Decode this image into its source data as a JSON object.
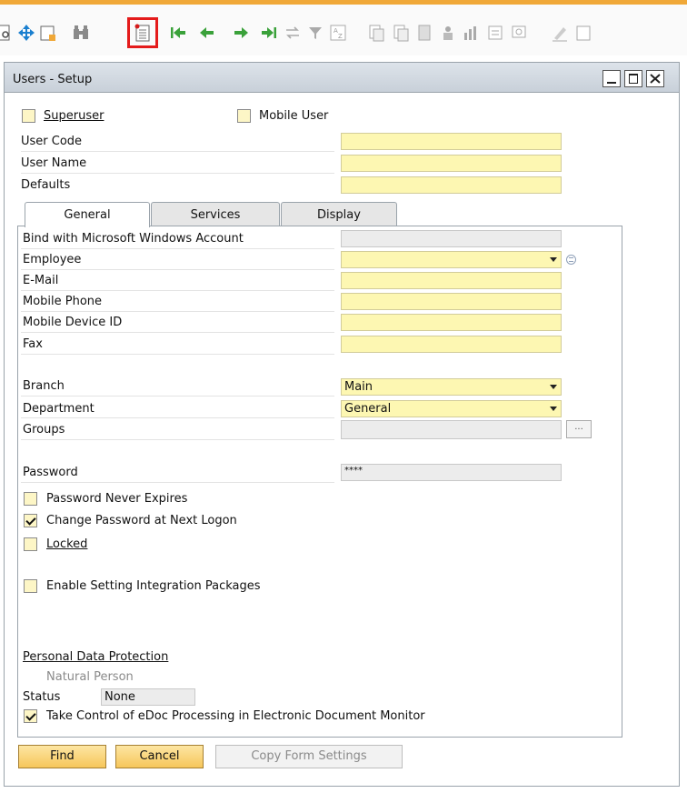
{
  "window": {
    "title": "Users - Setup"
  },
  "toolbar": {
    "icons": [
      "preview-icon",
      "navigate-icon",
      "export-icon",
      "find-binoculars-icon",
      "add-document-icon",
      "first-record-icon",
      "previous-record-icon",
      "next-record-icon",
      "last-record-icon",
      "refresh-icon",
      "filter-icon",
      "sort-icon",
      "base-document-icon",
      "target-document-icon",
      "journal-icon",
      "gross-profit-icon",
      "analysis-icon",
      "settings-icon",
      "messages-icon",
      "edit-icon",
      "layout-icon"
    ]
  },
  "header": {
    "superuser": {
      "label": "Superuser",
      "checked": false
    },
    "mobile_user": {
      "label": "Mobile User",
      "checked": false
    },
    "user_code": {
      "label": "User Code",
      "value": ""
    },
    "user_name": {
      "label": "User Name",
      "value": ""
    },
    "defaults": {
      "label": "Defaults",
      "value": ""
    }
  },
  "tabs": [
    "General",
    "Services",
    "Display"
  ],
  "general": {
    "bind_windows": {
      "label": "Bind with Microsoft Windows Account",
      "value": ""
    },
    "employee": {
      "label": "Employee",
      "value": ""
    },
    "email": {
      "label": "E-Mail",
      "value": ""
    },
    "mobile_phone": {
      "label": "Mobile Phone",
      "value": ""
    },
    "mobile_device": {
      "label": "Mobile Device ID",
      "value": ""
    },
    "fax": {
      "label": "Fax",
      "value": ""
    },
    "branch": {
      "label": "Branch",
      "value": "Main"
    },
    "department": {
      "label": "Department",
      "value": "General"
    },
    "groups": {
      "label": "Groups",
      "value": "",
      "button": "..."
    },
    "password": {
      "label": "Password",
      "value": "****"
    },
    "password_never_expires": {
      "label": "Password Never Expires",
      "checked": false
    },
    "change_password": {
      "label": "Change Password at Next Logon",
      "checked": true
    },
    "locked": {
      "label": "Locked",
      "checked": false
    },
    "enable_integration": {
      "label": "Enable Setting Integration Packages",
      "checked": false
    },
    "pdp": {
      "heading": "Personal Data Protection",
      "natural_person": "Natural Person",
      "status_label": "Status",
      "status_value": "None"
    },
    "edoc": {
      "label": "Take Control of eDoc Processing in Electronic Document Monitor",
      "checked": true
    }
  },
  "buttons": {
    "find": "Find",
    "cancel": "Cancel",
    "copy_form": "Copy Form Settings"
  },
  "colors": {
    "accent": "#f0a838",
    "required_field": "#fdf7b2",
    "highlight_box": "#e41b1b"
  }
}
